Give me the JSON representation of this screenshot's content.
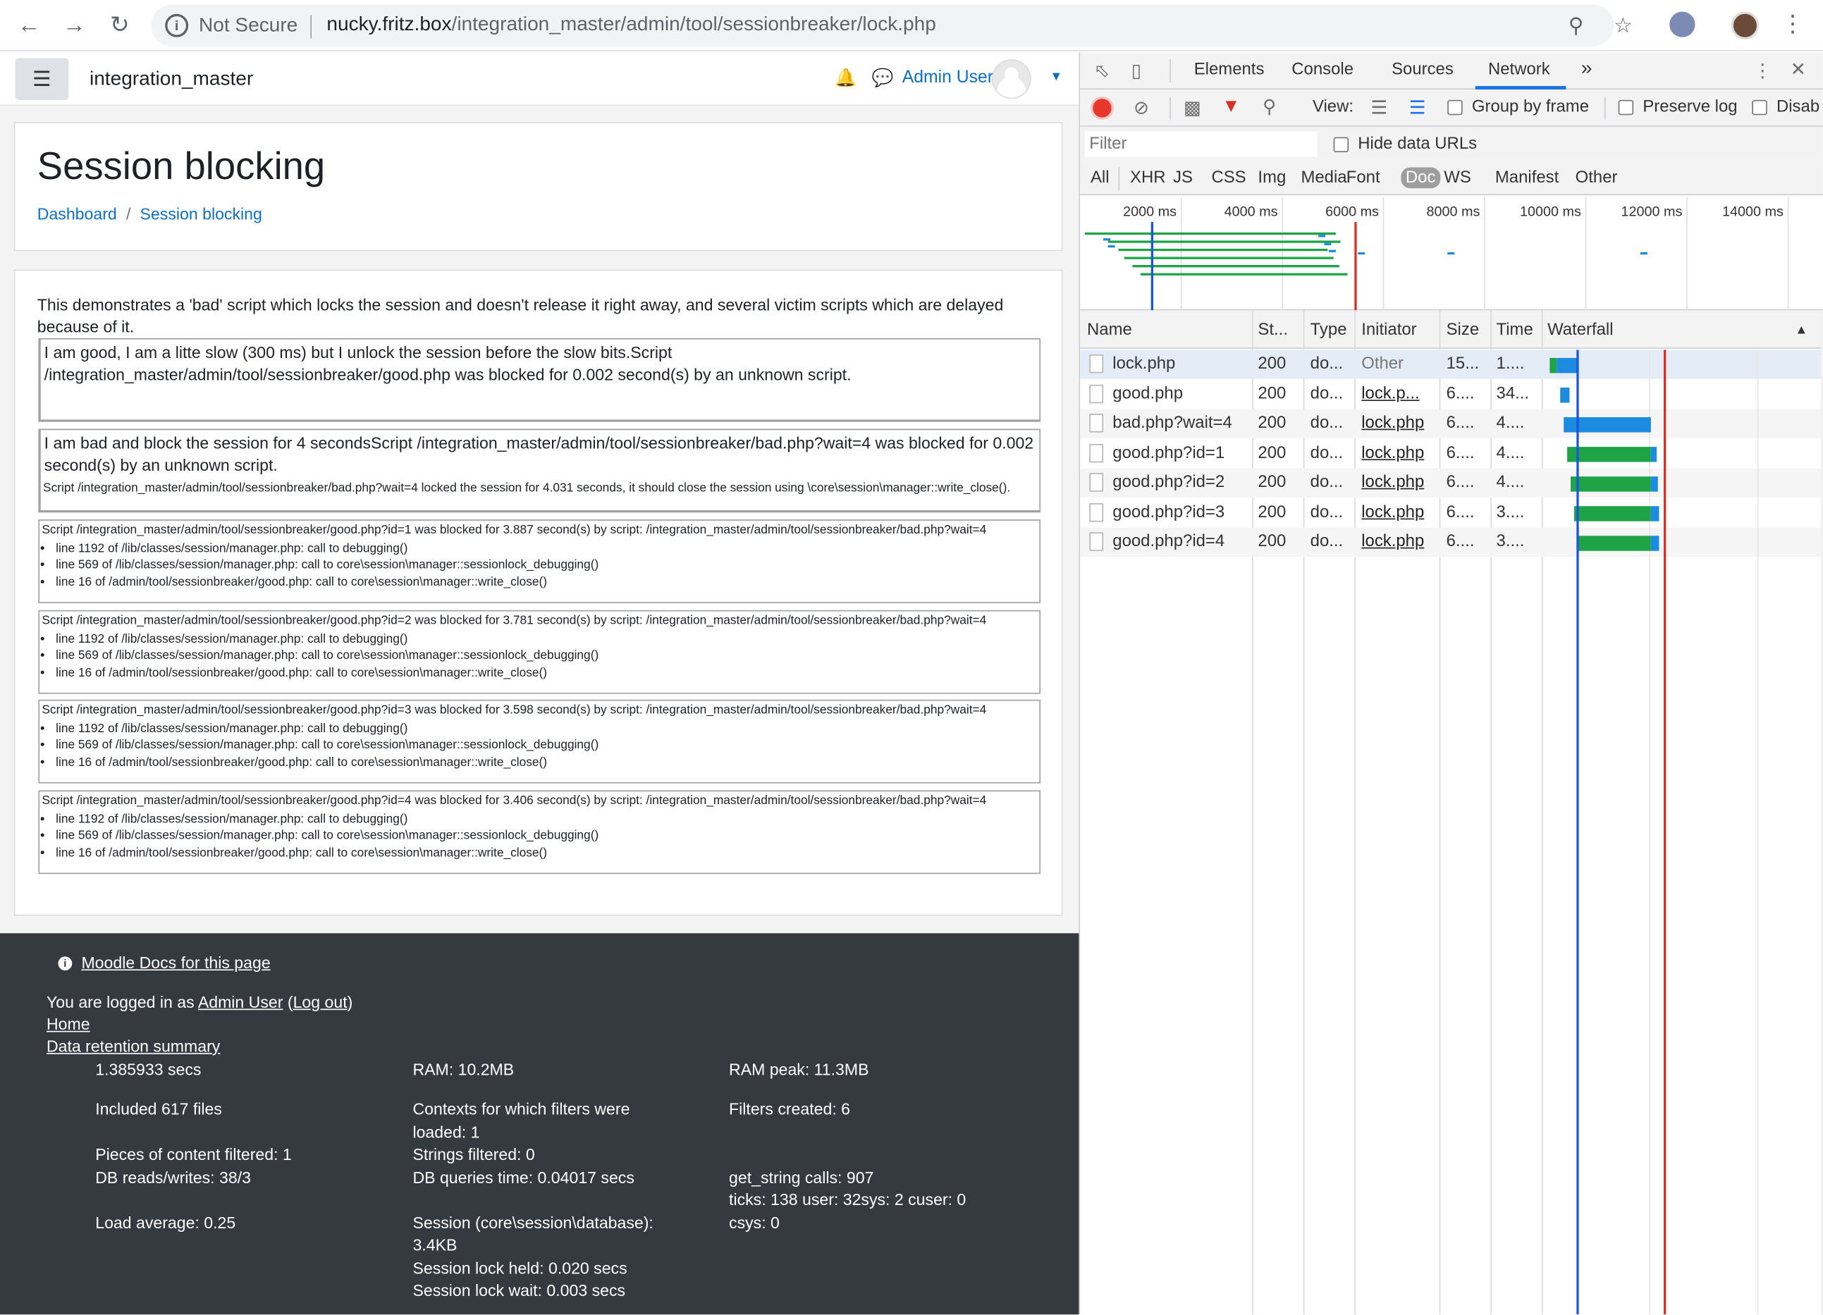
{
  "browser": {
    "security_label": "Not Secure",
    "url_host": "nucky.fritz.box",
    "url_path": "/integration_master/admin/tool/sessionbreaker/lock.php",
    "back_icon": "arrow-left-icon",
    "forward_icon": "arrow-right-icon",
    "reload_icon": "reload-icon"
  },
  "moodle": {
    "site_name": "integration_master",
    "user_name": "Admin User",
    "page_title": "Session blocking",
    "breadcrumbs": [
      "Dashboard",
      "Session blocking"
    ],
    "intro": "This demonstrates a 'bad' script which locks the session and doesn't release it right away, and several victim scripts which are delayed because of it.",
    "frames": [
      {
        "main": "I am good, I am a litte slow (300 ms) but I unlock the session before the slow bits.Script /integration_master/admin/tool/sessionbreaker/good.php was blocked for 0.002 second(s) by an unknown script."
      },
      {
        "main": "I am bad and block the session for 4 secondsScript /integration_master/admin/tool/sessionbreaker/bad.php?wait=4 was blocked for 0.002 second(s) by an unknown script.",
        "small": "Script /integration_master/admin/tool/sessionbreaker/bad.php?wait=4 locked the session for 4.031 seconds, it should close the session using \\core\\session\\manager::write_close()."
      },
      {
        "small": "Script /integration_master/admin/tool/sessionbreaker/good.php?id=1 was blocked for 3.887 second(s) by script: /integration_master/admin/tool/sessionbreaker/bad.php?wait=4",
        "lines": [
          "line 1192 of /lib/classes/session/manager.php: call to debugging()",
          "line 569 of /lib/classes/session/manager.php: call to core\\session\\manager::sessionlock_debugging()",
          "line 16 of /admin/tool/sessionbreaker/good.php: call to core\\session\\manager::write_close()"
        ]
      },
      {
        "small": "Script /integration_master/admin/tool/sessionbreaker/good.php?id=2 was blocked for 3.781 second(s) by script: /integration_master/admin/tool/sessionbreaker/bad.php?wait=4",
        "lines": [
          "line 1192 of /lib/classes/session/manager.php: call to debugging()",
          "line 569 of /lib/classes/session/manager.php: call to core\\session\\manager::sessionlock_debugging()",
          "line 16 of /admin/tool/sessionbreaker/good.php: call to core\\session\\manager::write_close()"
        ]
      },
      {
        "small": "Script /integration_master/admin/tool/sessionbreaker/good.php?id=3 was blocked for 3.598 second(s) by script: /integration_master/admin/tool/sessionbreaker/bad.php?wait=4",
        "lines": [
          "line 1192 of /lib/classes/session/manager.php: call to debugging()",
          "line 569 of /lib/classes/session/manager.php: call to core\\session\\manager::sessionlock_debugging()",
          "line 16 of /admin/tool/sessionbreaker/good.php: call to core\\session\\manager::write_close()"
        ]
      },
      {
        "small": "Script /integration_master/admin/tool/sessionbreaker/good.php?id=4 was blocked for 3.406 second(s) by script: /integration_master/admin/tool/sessionbreaker/bad.php?wait=4",
        "lines": [
          "line 1192 of /lib/classes/session/manager.php: call to debugging()",
          "line 569 of /lib/classes/session/manager.php: call to core\\session\\manager::sessionlock_debugging()",
          "line 16 of /admin/tool/sessionbreaker/good.php: call to core\\session\\manager::write_close()"
        ]
      }
    ],
    "footer": {
      "docs_link": "Moodle Docs for this page",
      "logged_in_prefix": "You are logged in as",
      "logged_in_user": "Admin User",
      "logout": "Log out",
      "home": "Home",
      "data_retention": "Data retention summary",
      "perf_col1": [
        "1.385933 secs",
        "Included 617 files",
        "Pieces of content filtered: 1",
        "DB reads/writes: 38/3",
        "Load average: 0.25"
      ],
      "perf_col2": [
        "RAM: 10.2MB",
        "Contexts for which filters were loaded: 1",
        "Strings filtered: 0",
        "DB queries time: 0.04017 secs",
        "Session (core\\session\\database): 3.4KB",
        "Session lock held: 0.020 secs",
        "Session lock wait: 0.003 secs"
      ],
      "perf_col3": [
        "RAM peak: 11.3MB",
        "Filters created: 6",
        "get_string calls: 907",
        "ticks: 138 user: 32sys: 2 cuser: 0 csys: 0"
      ]
    }
  },
  "devtools": {
    "tabs": [
      "Elements",
      "Console",
      "Sources",
      "Network"
    ],
    "active_tab": "Network",
    "more_tabs": "»",
    "toolbar": {
      "view_label": "View:",
      "group_by_frame": "Group by frame",
      "preserve_log": "Preserve log",
      "disable_cache": "Disab"
    },
    "filter_placeholder": "Filter",
    "hide_data_urls": "Hide data URLs",
    "types": [
      "All",
      "XHR",
      "JS",
      "CSS",
      "Img",
      "Media",
      "Font",
      "Doc",
      "WS",
      "Manifest",
      "Other"
    ],
    "active_type": "Doc",
    "overview_labels": [
      "2000 ms",
      "4000 ms",
      "6000 ms",
      "8000 ms",
      "10000 ms",
      "12000 ms",
      "14000 ms"
    ],
    "columns": [
      "Name",
      "St...",
      "Type",
      "Initiator",
      "Size",
      "Time",
      "Waterfall"
    ],
    "sort_icon": "triangle-up-icon",
    "rows": [
      {
        "name": "lock.php",
        "status": "200",
        "type": "do...",
        "initiator": "Other",
        "initiator_link": false,
        "size": "15...",
        "time": "1...."
      },
      {
        "name": "good.php",
        "status": "200",
        "type": "do...",
        "initiator": "lock.p...",
        "initiator_link": true,
        "size": "6....",
        "time": "34..."
      },
      {
        "name": "bad.php?wait=4",
        "status": "200",
        "type": "do...",
        "initiator": "lock.php",
        "initiator_link": true,
        "size": "6....",
        "time": "4...."
      },
      {
        "name": "good.php?id=1",
        "status": "200",
        "type": "do...",
        "initiator": "lock.php",
        "initiator_link": true,
        "size": "6....",
        "time": "4...."
      },
      {
        "name": "good.php?id=2",
        "status": "200",
        "type": "do...",
        "initiator": "lock.php",
        "initiator_link": true,
        "size": "6....",
        "time": "4...."
      },
      {
        "name": "good.php?id=3",
        "status": "200",
        "type": "do...",
        "initiator": "lock.php",
        "initiator_link": true,
        "size": "6....",
        "time": "3...."
      },
      {
        "name": "good.php?id=4",
        "status": "200",
        "type": "do...",
        "initiator": "lock.php",
        "initiator_link": true,
        "size": "6....",
        "time": "3...."
      }
    ],
    "colors": {
      "waiting": "#1ea446",
      "download": "#1c8be0",
      "load_line": "#d93025",
      "dcl_line": "#1a56db"
    }
  }
}
